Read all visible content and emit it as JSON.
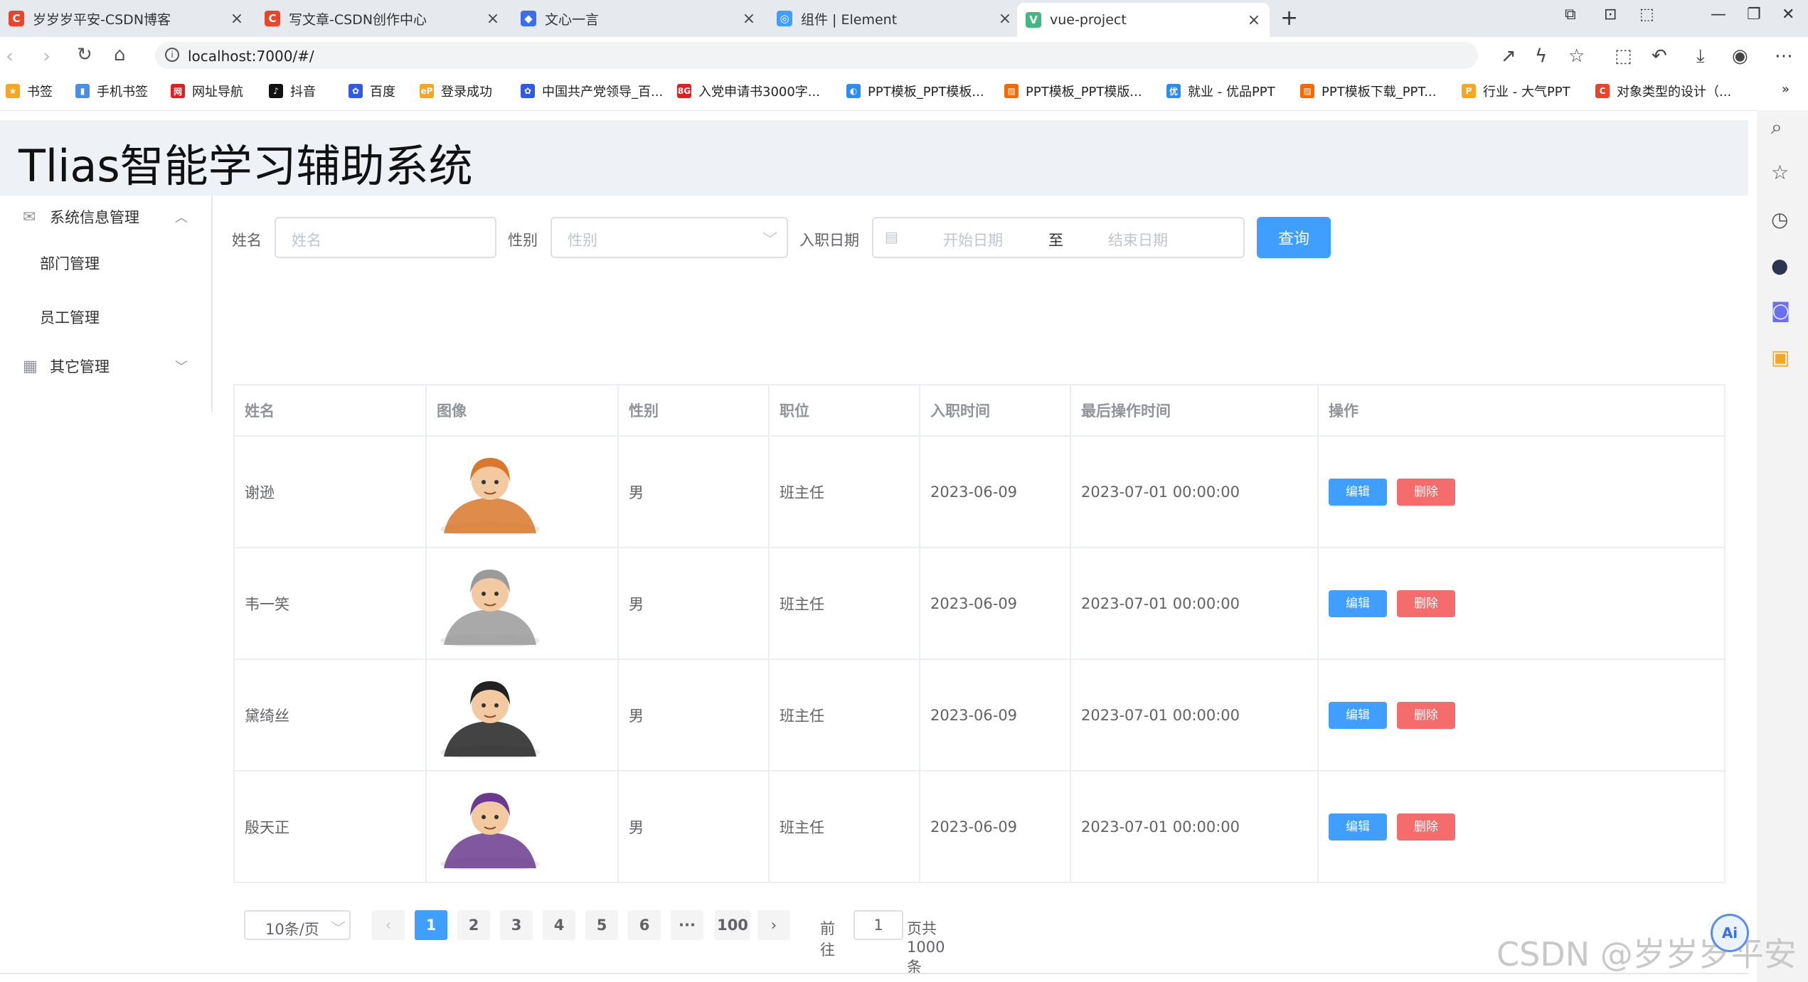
{
  "browser": {
    "tabs": [
      {
        "title": "岁岁岁平安-CSDN博客",
        "fav": "C",
        "color": "#e8462a"
      },
      {
        "title": "写文章-CSDN创作中心",
        "fav": "C",
        "color": "#e8462a"
      },
      {
        "title": "文心一言",
        "fav": "◆",
        "color": "#3a6ee8"
      },
      {
        "title": "组件 | Element",
        "fav": "◎",
        "color": "#409eff"
      },
      {
        "title": "vue-project",
        "fav": "V",
        "color": "#41b883"
      }
    ],
    "url": "localhost:7000/#/",
    "bookmarks": [
      {
        "label": "书签",
        "icon": "★",
        "color": "#f5a623"
      },
      {
        "label": "手机书签",
        "icon": "▮",
        "color": "#4a90e2"
      },
      {
        "label": "网址导航",
        "icon": "网",
        "color": "#e02020"
      },
      {
        "label": "抖音",
        "icon": "♪",
        "color": "#111111"
      },
      {
        "label": "百度",
        "icon": "✿",
        "color": "#2d5be3"
      },
      {
        "label": "登录成功",
        "icon": "eP",
        "color": "#f5a623"
      },
      {
        "label": "中国共产党领导_百...",
        "icon": "✿",
        "color": "#2d5be3"
      },
      {
        "label": "入党申请书3000字...",
        "icon": "8G",
        "color": "#e02020"
      },
      {
        "label": "PPT模板_PPT模板...",
        "icon": "◐",
        "color": "#2d8cf0"
      },
      {
        "label": "PPT模板_PPT模版...",
        "icon": "▨",
        "color": "#f56a00"
      },
      {
        "label": "就业 - 优品PPT",
        "icon": "优",
        "color": "#2d8cf0"
      },
      {
        "label": "PPT模板下载_PPT...",
        "icon": "▨",
        "color": "#f56a00"
      },
      {
        "label": "行业 - 大气PPT",
        "icon": "P",
        "color": "#f5a623"
      },
      {
        "label": "对象类型的设计（...",
        "icon": "C",
        "color": "#e8462a"
      }
    ]
  },
  "app": {
    "title": "Tlias智能学习辅助系统",
    "menu": {
      "group1": "系统信息管理",
      "items": [
        "部门管理",
        "员工管理"
      ],
      "group2": "其它管理"
    },
    "search": {
      "name_label": "姓名",
      "name_placeholder": "姓名",
      "gender_label": "性别",
      "gender_placeholder": "性别",
      "date_label": "入职日期",
      "start_placeholder": "开始日期",
      "date_separator": "至",
      "end_placeholder": "结束日期",
      "query_button": "查询"
    },
    "table": {
      "headers": [
        "姓名",
        "图像",
        "性别",
        "职位",
        "入职时间",
        "最后操作时间",
        "操作"
      ],
      "rows": [
        {
          "name": "谢逊",
          "gender": "男",
          "job": "班主任",
          "entry": "2023-06-09",
          "update": "2023-07-01 00:00:00",
          "avatar_color": "#d9782a"
        },
        {
          "name": "韦一笑",
          "gender": "男",
          "job": "班主任",
          "entry": "2023-06-09",
          "update": "2023-07-01 00:00:00",
          "avatar_color": "#9a9a9a"
        },
        {
          "name": "黛绮丝",
          "gender": "男",
          "job": "班主任",
          "entry": "2023-06-09",
          "update": "2023-07-01 00:00:00",
          "avatar_color": "#222222"
        },
        {
          "name": "殷天正",
          "gender": "男",
          "job": "班主任",
          "entry": "2023-06-09",
          "update": "2023-07-01 00:00:00",
          "avatar_color": "#6b3a8e"
        }
      ],
      "edit_label": "编辑",
      "delete_label": "删除"
    },
    "pagination": {
      "page_size": "10条/页",
      "pages": [
        "1",
        "2",
        "3",
        "4",
        "5",
        "6",
        "···",
        "100"
      ],
      "current": "1",
      "goto_label": "前往",
      "goto_value": "1",
      "total_label": "页共 1000 条"
    }
  },
  "watermark": "CSDN @岁岁岁平安"
}
